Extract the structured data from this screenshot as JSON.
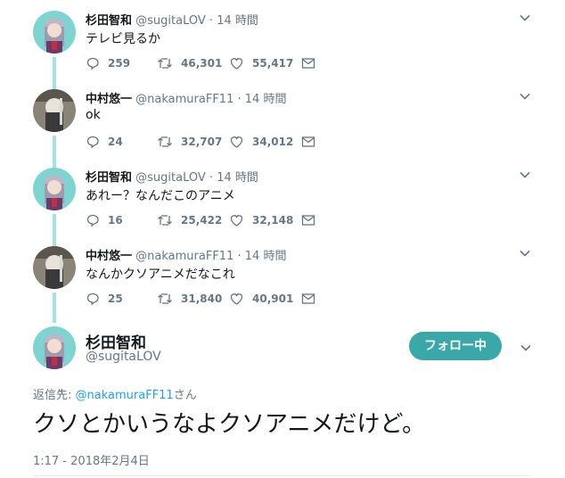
{
  "tweets": [
    {
      "name": "杉田智和",
      "handle": "@sugitaLOV",
      "dot": "·",
      "time": "14 時間",
      "text": "テレビ見るか",
      "replies": "259",
      "retweets": "46,301",
      "likes": "55,417",
      "avatar": "sugita"
    },
    {
      "name": "中村悠一",
      "handle": "@nakamuraFF11",
      "dot": "·",
      "time": "14 時間",
      "text": "ok",
      "replies": "24",
      "retweets": "32,707",
      "likes": "34,012",
      "avatar": "nakamura"
    },
    {
      "name": "杉田智和",
      "handle": "@sugitaLOV",
      "dot": "·",
      "time": "14 時間",
      "text": "あれー？なんだこのアニメ",
      "replies": "16",
      "retweets": "25,422",
      "likes": "32,148",
      "avatar": "sugita"
    },
    {
      "name": "中村悠一",
      "handle": "@nakamuraFF11",
      "dot": "·",
      "time": "14 時間",
      "text": "なんかクソアニメだなこれ",
      "replies": "25",
      "retweets": "31,840",
      "likes": "40,901",
      "avatar": "nakamura"
    }
  ],
  "focused": {
    "name": "杉田智和",
    "handle": "@sugitaLOV",
    "follow_label": "フォロー中",
    "reply_prefix": "返信先: ",
    "reply_link": "@nakamuraFF11",
    "reply_suffix": "さん",
    "text": "クソとかいうなよクソアニメだけど。",
    "timestamp": "1:17 - 2018年2月4日"
  },
  "colors": {
    "accent": "#3aa8a8",
    "link": "#1da1f2",
    "thread_line": "#a4e4e0",
    "muted": "#657786"
  },
  "icons": {
    "reply": "reply-icon",
    "retweet": "retweet-icon",
    "like": "heart-icon",
    "dm": "envelope-icon",
    "more": "chevron-down-icon"
  }
}
